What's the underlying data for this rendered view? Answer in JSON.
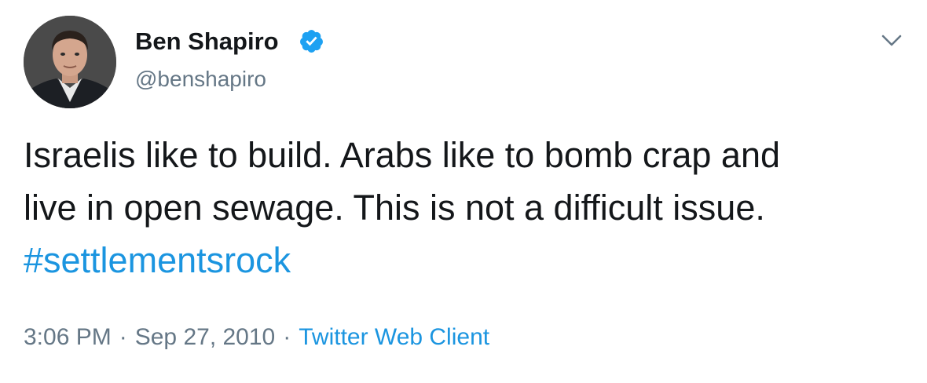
{
  "author": {
    "name": "Ben Shapiro",
    "handle": "@benshapiro",
    "verified": true
  },
  "tweet": {
    "text_lines": [
      "Israelis like to build. Arabs like to bomb crap and",
      "live in open sewage. This is not a difficult issue."
    ],
    "hashtag": "#settlementsrock"
  },
  "meta": {
    "time": "3:06 PM",
    "separator": "·",
    "date": "Sep 27, 2010",
    "source": "Twitter Web Client"
  },
  "colors": {
    "text": "#14171a",
    "secondary": "#657786",
    "link": "#1b95e0",
    "verified": "#1da1f2"
  },
  "icons": {
    "verified": "verified-badge-icon",
    "menu": "chevron-down-icon"
  }
}
